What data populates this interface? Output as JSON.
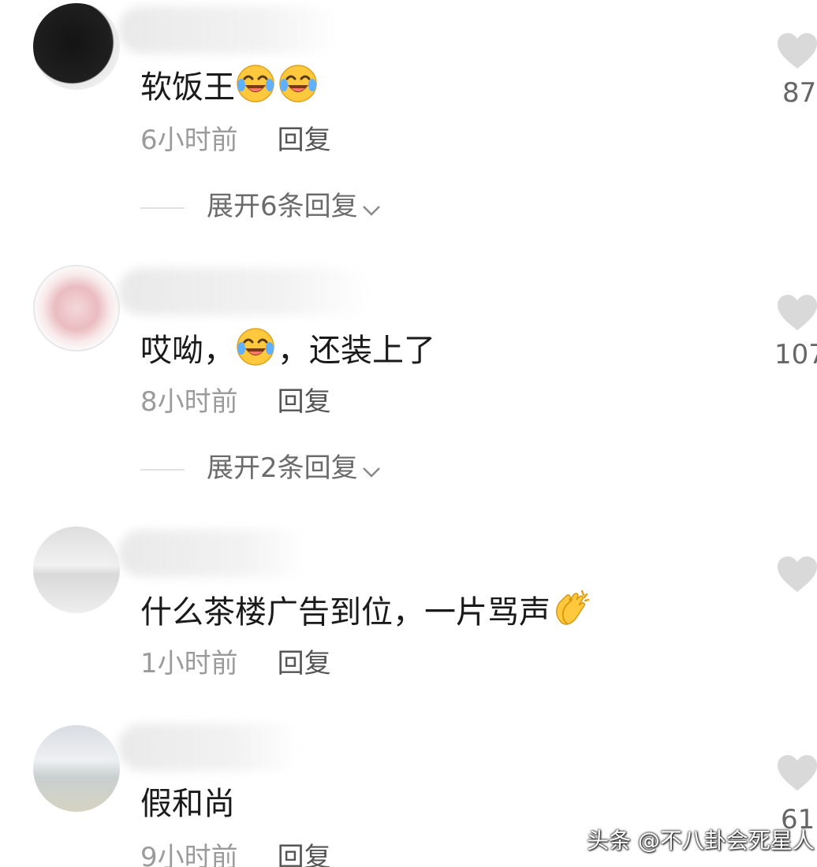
{
  "comments": [
    {
      "text": "软饭王",
      "emoji": [
        "laughing-tears-face-icon",
        "laughing-tears-face-icon"
      ],
      "time": "6小时前",
      "reply_label": "回复",
      "expand_label": "展开6条回复",
      "likes": "87"
    },
    {
      "text_before": "哎呦，",
      "emoji": [
        "laughing-tears-face-icon"
      ],
      "text_after": "，还装上了",
      "time": "8小时前",
      "reply_label": "回复",
      "expand_label": "展开2条回复",
      "likes": "107"
    },
    {
      "text": "什么茶楼广告到位，一片骂声",
      "emoji": [
        "clapping-hands-icon"
      ],
      "time": "1小时前",
      "reply_label": "回复",
      "likes": ""
    },
    {
      "text": "假和尚",
      "time": "9小时前",
      "reply_label": "回复",
      "likes": "61"
    }
  ],
  "watermark": "头条 @不八卦会死星人",
  "colors": {
    "text": "#1a1a1a",
    "meta": "#9b9b9b",
    "reply": "#555555",
    "heart": "#d9d9d9"
  }
}
